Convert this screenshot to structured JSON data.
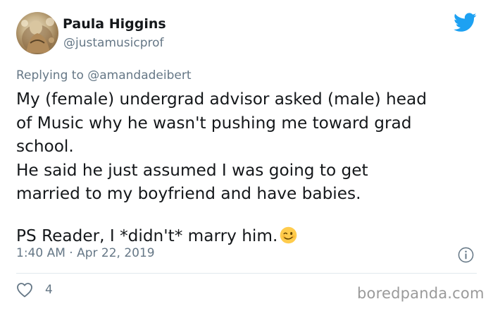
{
  "tweet": {
    "author_name": "Paula Higgins",
    "author_handle": "@justamusicprof",
    "replying_label": "Replying to",
    "replying_to": "@amandadeibert",
    "body_lines": [
      "My (female) undergrad advisor asked (male) head",
      "of Music why he wasn't pushing me toward grad",
      "school.",
      "He said he just assumed I was going to get",
      "married to my boyfriend and have babies."
    ],
    "ps_line": "PS  Reader, I *didn't* marry him.",
    "emoji": "winking-face",
    "timestamp": "1:40 AM · Apr 22, 2019",
    "like_count": "4"
  },
  "watermark": "boredpanda.com",
  "colors": {
    "twitter_blue": "#1da1f2",
    "secondary_text": "#657786",
    "primary_text": "#14171a",
    "divider": "#e1e8ed",
    "watermark": "#9a9a9a"
  },
  "icons": {
    "brand": "twitter-bird-icon",
    "info": "info-icon",
    "like": "heart-outline-icon"
  }
}
